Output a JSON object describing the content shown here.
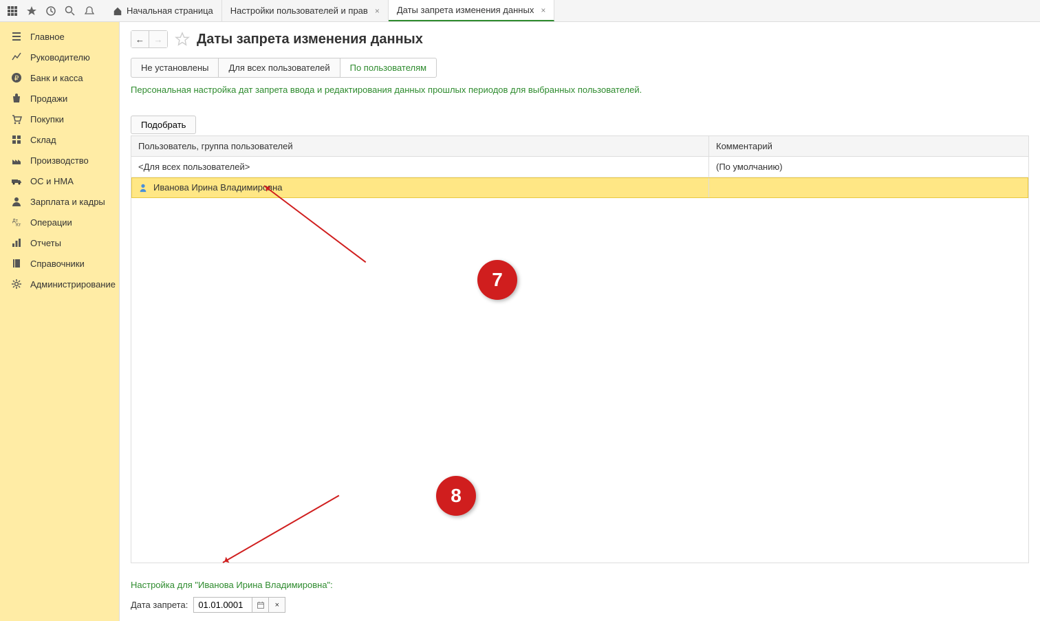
{
  "toolbar": {
    "tabs": [
      {
        "label": "Начальная страница",
        "has_home_icon": true,
        "closable": false
      },
      {
        "label": "Настройки пользователей и прав",
        "closable": true
      },
      {
        "label": "Даты запрета изменения данных",
        "closable": true,
        "active": true
      }
    ]
  },
  "sidebar": {
    "items": [
      {
        "label": "Главное",
        "icon": "menu"
      },
      {
        "label": "Руководителю",
        "icon": "trend"
      },
      {
        "label": "Банк и касса",
        "icon": "ruble"
      },
      {
        "label": "Продажи",
        "icon": "bag"
      },
      {
        "label": "Покупки",
        "icon": "cart"
      },
      {
        "label": "Склад",
        "icon": "warehouse"
      },
      {
        "label": "Производство",
        "icon": "factory"
      },
      {
        "label": "ОС и НМА",
        "icon": "truck"
      },
      {
        "label": "Зарплата и кадры",
        "icon": "person"
      },
      {
        "label": "Операции",
        "icon": "ops"
      },
      {
        "label": "Отчеты",
        "icon": "chart"
      },
      {
        "label": "Справочники",
        "icon": "book"
      },
      {
        "label": "Администрирование",
        "icon": "gear"
      }
    ]
  },
  "page": {
    "title": "Даты запрета изменения данных",
    "filter_tabs": [
      {
        "label": "Не установлены"
      },
      {
        "label": "Для всех пользователей"
      },
      {
        "label": "По пользователям",
        "active": true
      }
    ],
    "hint": "Персональная настройка дат запрета ввода и редактирования данных прошлых периодов для выбранных пользователей.",
    "select_button": "Подобрать",
    "table": {
      "headers": {
        "user": "Пользователь, группа пользователей",
        "comment": "Комментарий"
      },
      "rows": [
        {
          "user": "<Для всех пользователей>",
          "comment": "(По умолчанию)",
          "has_icon": false
        },
        {
          "user": "Иванова Ирина Владимировна",
          "comment": "",
          "has_icon": true,
          "selected": true
        }
      ]
    },
    "settings_for": "Настройка для \"Иванова Ирина Владимировна\":",
    "date_label": "Дата запрета:",
    "date_value": "01.01.0001"
  },
  "annotations": {
    "marker7": "7",
    "marker8": "8"
  }
}
